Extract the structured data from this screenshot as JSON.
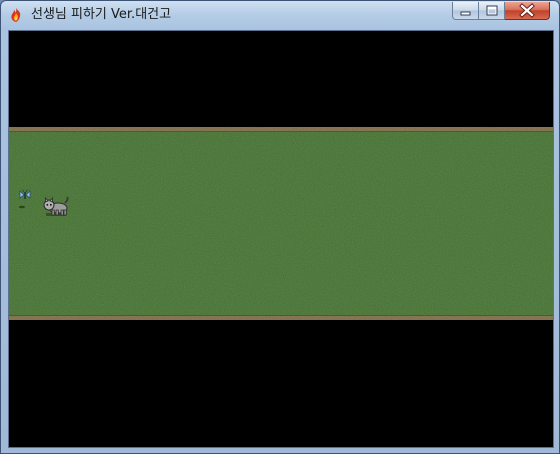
{
  "window": {
    "title": "선생님 피하기 Ver.대건고",
    "app_icon": "flame-app-icon",
    "controls": {
      "minimize_icon": "minimize-icon",
      "maximize_icon": "maximize-icon",
      "close_icon": "close-icon"
    },
    "colors": {
      "frame": "#a9c3e0",
      "close_button": "#c9452f"
    }
  },
  "game": {
    "background_color": "#000000",
    "field_color": "#3f6a2c",
    "dirt_edge_color": "#7c6a45",
    "entities": [
      {
        "name": "butterfly",
        "icon": "butterfly-sprite",
        "color": "#6fa7d6"
      },
      {
        "name": "cat",
        "icon": "cat-sprite",
        "color": "#9a9a9a"
      }
    ]
  }
}
